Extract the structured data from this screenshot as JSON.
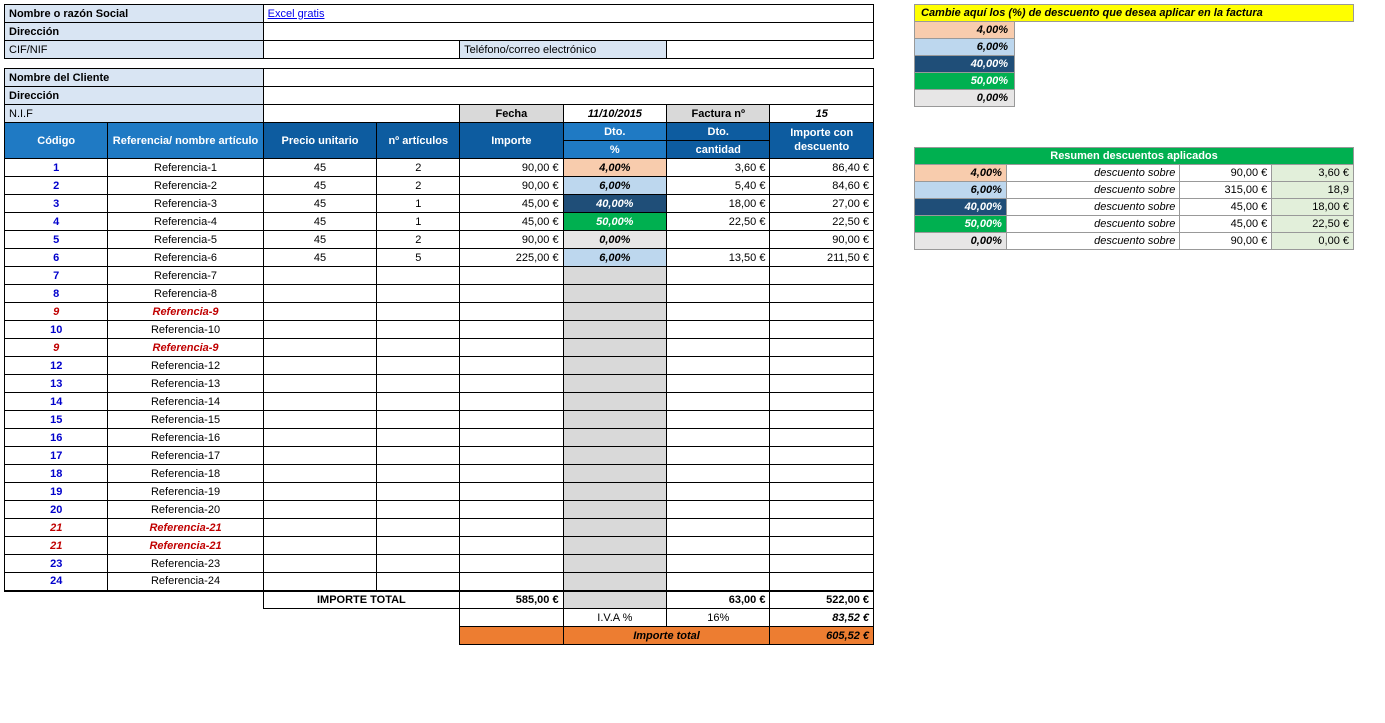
{
  "header": {
    "razonSocialLbl": "Nombre o razón Social",
    "razonSocialVal": "Excel gratis",
    "direccionLbl": "Dirección",
    "cifLbl": "CIF/NIF",
    "telLbl": "Teléfono/correo electrónico",
    "clienteLbl": "Nombre del Cliente",
    "nifLbl": "N.I.F",
    "fechaLbl": "Fecha",
    "fechaVal": "11/10/2015",
    "facturaLbl": "Factura nº",
    "facturaVal": "15"
  },
  "cols": {
    "codigo": "Código",
    "ref": "Referencia/ nombre artículo",
    "precio": "Precio unitario",
    "nart": "nº artículos",
    "importe": "Importe",
    "dto": "Dto.",
    "pct": "%",
    "dtoCant": "Dto.",
    "cantidad": "cantidad",
    "importeDesc": "Importe con descuento"
  },
  "items": [
    {
      "code": "1",
      "ref": "Referencia-1",
      "pu": "45",
      "n": "2",
      "imp": "90,00 €",
      "dtoClass": "dto4",
      "dto": "4,00%",
      "dtoCant": "3,60 €",
      "impd": "86,40 €"
    },
    {
      "code": "2",
      "ref": "Referencia-2",
      "pu": "45",
      "n": "2",
      "imp": "90,00 €",
      "dtoClass": "dto6",
      "dto": "6,00%",
      "dtoCant": "5,40 €",
      "impd": "84,60 €"
    },
    {
      "code": "3",
      "ref": "Referencia-3",
      "pu": "45",
      "n": "1",
      "imp": "45,00 €",
      "dtoClass": "dto40",
      "dto": "40,00%",
      "dtoCant": "18,00 €",
      "impd": "27,00 €"
    },
    {
      "code": "4",
      "ref": "Referencia-4",
      "pu": "45",
      "n": "1",
      "imp": "45,00 €",
      "dtoClass": "dto50",
      "dto": "50,00%",
      "dtoCant": "22,50 €",
      "impd": "22,50 €"
    },
    {
      "code": "5",
      "ref": "Referencia-5",
      "pu": "45",
      "n": "2",
      "imp": "90,00 €",
      "dtoClass": "dto0",
      "dto": "0,00%",
      "dtoCant": "",
      "impd": "90,00 €"
    },
    {
      "code": "6",
      "ref": "Referencia-6",
      "pu": "45",
      "n": "5",
      "imp": "225,00 €",
      "dtoClass": "dto6",
      "dto": "6,00%",
      "dtoCant": "13,50 €",
      "impd": "211,50 €"
    },
    {
      "code": "7",
      "ref": "Referencia-7"
    },
    {
      "code": "8",
      "ref": "Referencia-8"
    },
    {
      "code": "9",
      "ref": "Referencia-9",
      "red": true
    },
    {
      "code": "10",
      "ref": "Referencia-10"
    },
    {
      "code": "9",
      "ref": "Referencia-9",
      "red": true
    },
    {
      "code": "12",
      "ref": "Referencia-12"
    },
    {
      "code": "13",
      "ref": "Referencia-13"
    },
    {
      "code": "14",
      "ref": "Referencia-14"
    },
    {
      "code": "15",
      "ref": "Referencia-15"
    },
    {
      "code": "16",
      "ref": "Referencia-16"
    },
    {
      "code": "17",
      "ref": "Referencia-17"
    },
    {
      "code": "18",
      "ref": "Referencia-18"
    },
    {
      "code": "19",
      "ref": "Referencia-19"
    },
    {
      "code": "20",
      "ref": "Referencia-20"
    },
    {
      "code": "21",
      "ref": "Referencia-21",
      "red": true
    },
    {
      "code": "21",
      "ref": "Referencia-21",
      "red": true
    },
    {
      "code": "23",
      "ref": "Referencia-23"
    },
    {
      "code": "24",
      "ref": "Referencia-24"
    }
  ],
  "totals": {
    "importeTotalLbl": "IMPORTE TOTAL",
    "importeTotalVal": "585,00 €",
    "dtoTotal": "63,00 €",
    "impdTotal": "522,00 €",
    "ivaLbl": "I.V.A %",
    "ivaPct": "16%",
    "ivaVal": "83,52 €",
    "finalLbl": "Importe total",
    "finalVal": "605,52 €"
  },
  "config": {
    "banner": "Cambie aquí los (%) de descuento que desea aplicar en la factura",
    "rates": [
      {
        "cls": "dto4",
        "val": "4,00%"
      },
      {
        "cls": "dto6",
        "val": "6,00%"
      },
      {
        "cls": "dto40",
        "val": "40,00%"
      },
      {
        "cls": "dto50",
        "val": "50,00%"
      },
      {
        "cls": "dto0",
        "val": "0,00%"
      }
    ]
  },
  "summary": {
    "title": "Resumen descuentos aplicados",
    "lbl": "descuento sobre",
    "rows": [
      {
        "cls": "dto4",
        "pct": "4,00%",
        "imp": "90,00 €",
        "dto": "3,60 €"
      },
      {
        "cls": "dto6",
        "pct": "6,00%",
        "imp": "315,00 €",
        "dto": "18,9"
      },
      {
        "cls": "dto40",
        "pct": "40,00%",
        "imp": "45,00 €",
        "dto": "18,00 €"
      },
      {
        "cls": "dto50",
        "pct": "50,00%",
        "imp": "45,00 €",
        "dto": "22,50 €"
      },
      {
        "cls": "dto0",
        "pct": "0,00%",
        "imp": "90,00 €",
        "dto": "0,00 €"
      }
    ]
  }
}
